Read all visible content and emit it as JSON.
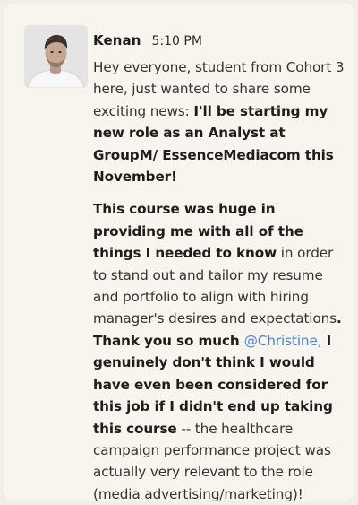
{
  "message": {
    "author": "Kenan",
    "time": "5:10 PM",
    "p1": {
      "t1": "Hey everyone, student from Cohort 3 here, just wanted to share some exciting news: ",
      "b1": "I'll be starting my new role as an Analyst at GroupM/ EssenceMediacom this November!"
    },
    "p2": {
      "b1": "This course was huge in providing me with all of the things I needed to know",
      "t1": " in order to stand out and tailor my resume and portfolio to align with hiring manager's desires and expectations",
      "b2": ". Thank you so much ",
      "mention": "@Christine,",
      "b3": " I genuinely don't think I would have even been considered for this job if I didn't end up taking this course",
      "t2": " -- the healthcare campaign performance project was actually very relevant to the role (media advertising/marketing)!"
    }
  },
  "colors": {
    "card_background": "#f8f4ee",
    "text": "#333333",
    "mention": "#4a80d6"
  }
}
